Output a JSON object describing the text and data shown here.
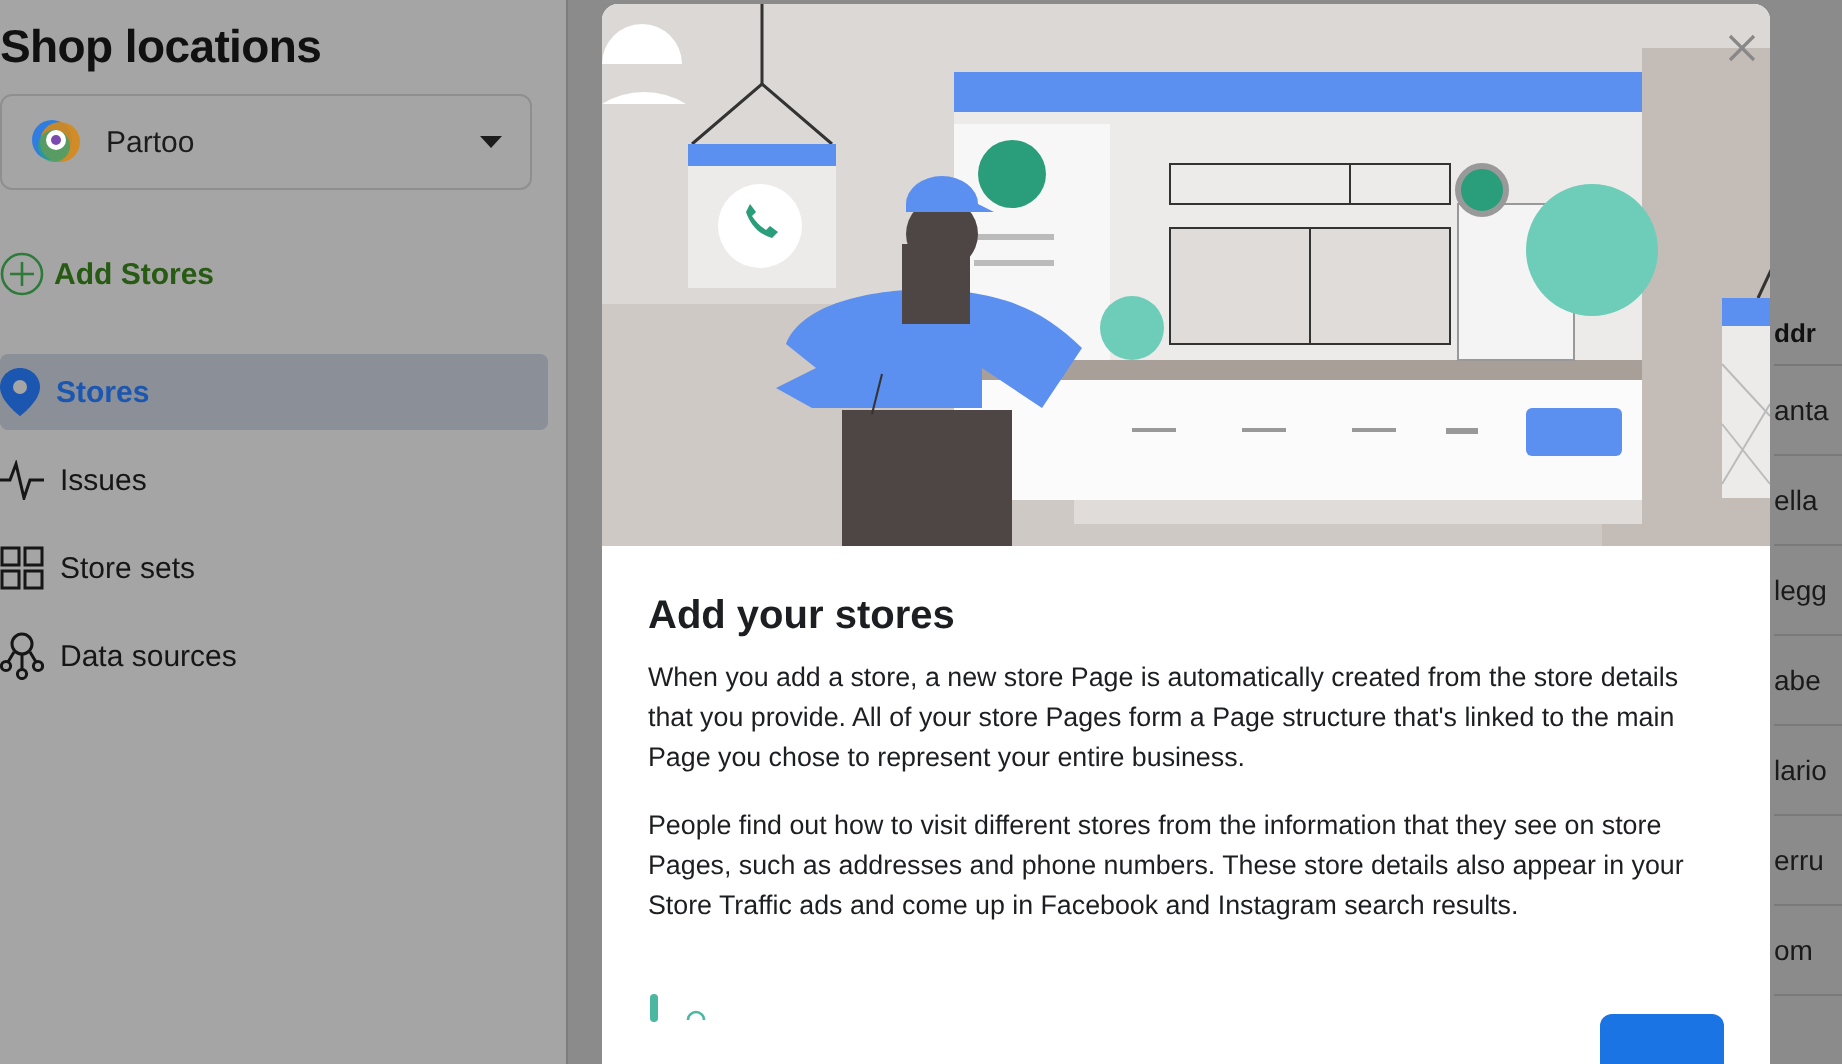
{
  "sidebar": {
    "title": "Shop locations",
    "account": {
      "name": "Partoo"
    },
    "add_action": {
      "label": "Add Stores"
    },
    "items": [
      {
        "label": "Stores",
        "selected": true
      },
      {
        "label": "Issues",
        "selected": false
      },
      {
        "label": "Store sets",
        "selected": false
      },
      {
        "label": "Data sources",
        "selected": false
      }
    ]
  },
  "table": {
    "column_1": {
      "header": "ddr",
      "cells": [
        "anta",
        "ella",
        "legg",
        "abe",
        "lario",
        "erru",
        "om"
      ]
    }
  },
  "modal": {
    "title": "Add your stores",
    "paragraphs": [
      "When you add a store, a new store Page is automatically created from the store details that you provide. All of your store Pages form a Page structure that's linked to the main Page you chose to represent your entire business.",
      "People find out how to visit different stores from the information that they see on store Pages, such as addresses and phone numbers. These store details also appear in your Store Traffic ads and come up in Facebook and Instagram search results."
    ]
  }
}
